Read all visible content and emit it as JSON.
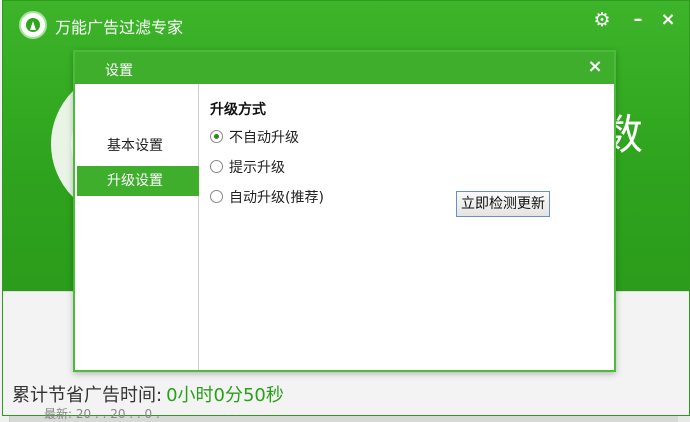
{
  "app": {
    "title": "万能广告过滤专家",
    "big_char": "数",
    "savings_label": "累计节省广告时间:",
    "savings_value": "0小时0分50秒",
    "footer_sub": "最新: 20 . . 20 . . 0 .",
    "icons": {
      "logo": "app-logo-icon",
      "settings": "gear-icon",
      "minimize": "minimize-icon",
      "close": "close-icon"
    }
  },
  "dialog": {
    "title": "设置",
    "close_glyph": "×",
    "nav": [
      {
        "label": "基本设置",
        "active": false
      },
      {
        "label": "升级设置",
        "active": true
      }
    ],
    "section_title": "升级方式",
    "options": [
      {
        "label": "不自动升级",
        "checked": true
      },
      {
        "label": "提示升级",
        "checked": false
      },
      {
        "label": "自动升级(推荐)",
        "checked": false
      }
    ],
    "check_update_button": "立即检测更新"
  },
  "colors": {
    "brand_green": "#3eae2c",
    "value_green": "#2aa01a"
  }
}
